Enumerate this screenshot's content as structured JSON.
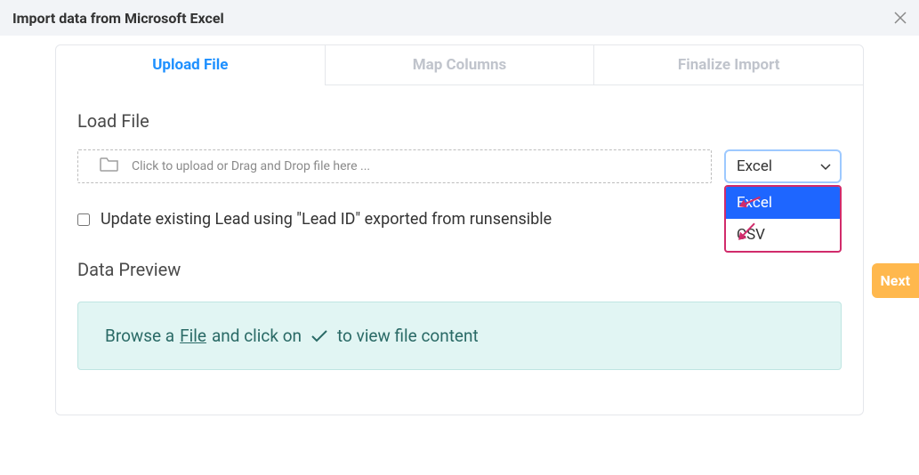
{
  "header": {
    "title": "Import data from Microsoft Excel"
  },
  "tabs": {
    "upload": "Upload File",
    "map": "Map Columns",
    "finalize": "Finalize Import"
  },
  "sections": {
    "load_file": "Load File",
    "data_preview": "Data Preview"
  },
  "dropzone": {
    "text": "Click to upload or Drag and Drop file here ..."
  },
  "file_type": {
    "selected": "Excel",
    "options": {
      "excel": "Excel",
      "csv": "CSV"
    }
  },
  "checkbox": {
    "label": "Update existing Lead using \"Lead ID\" exported from runsensible"
  },
  "info": {
    "prefix": "Browse a ",
    "file_word": "File",
    "middle": " and click on ",
    "suffix": " to view file content"
  },
  "buttons": {
    "next": "Next"
  }
}
